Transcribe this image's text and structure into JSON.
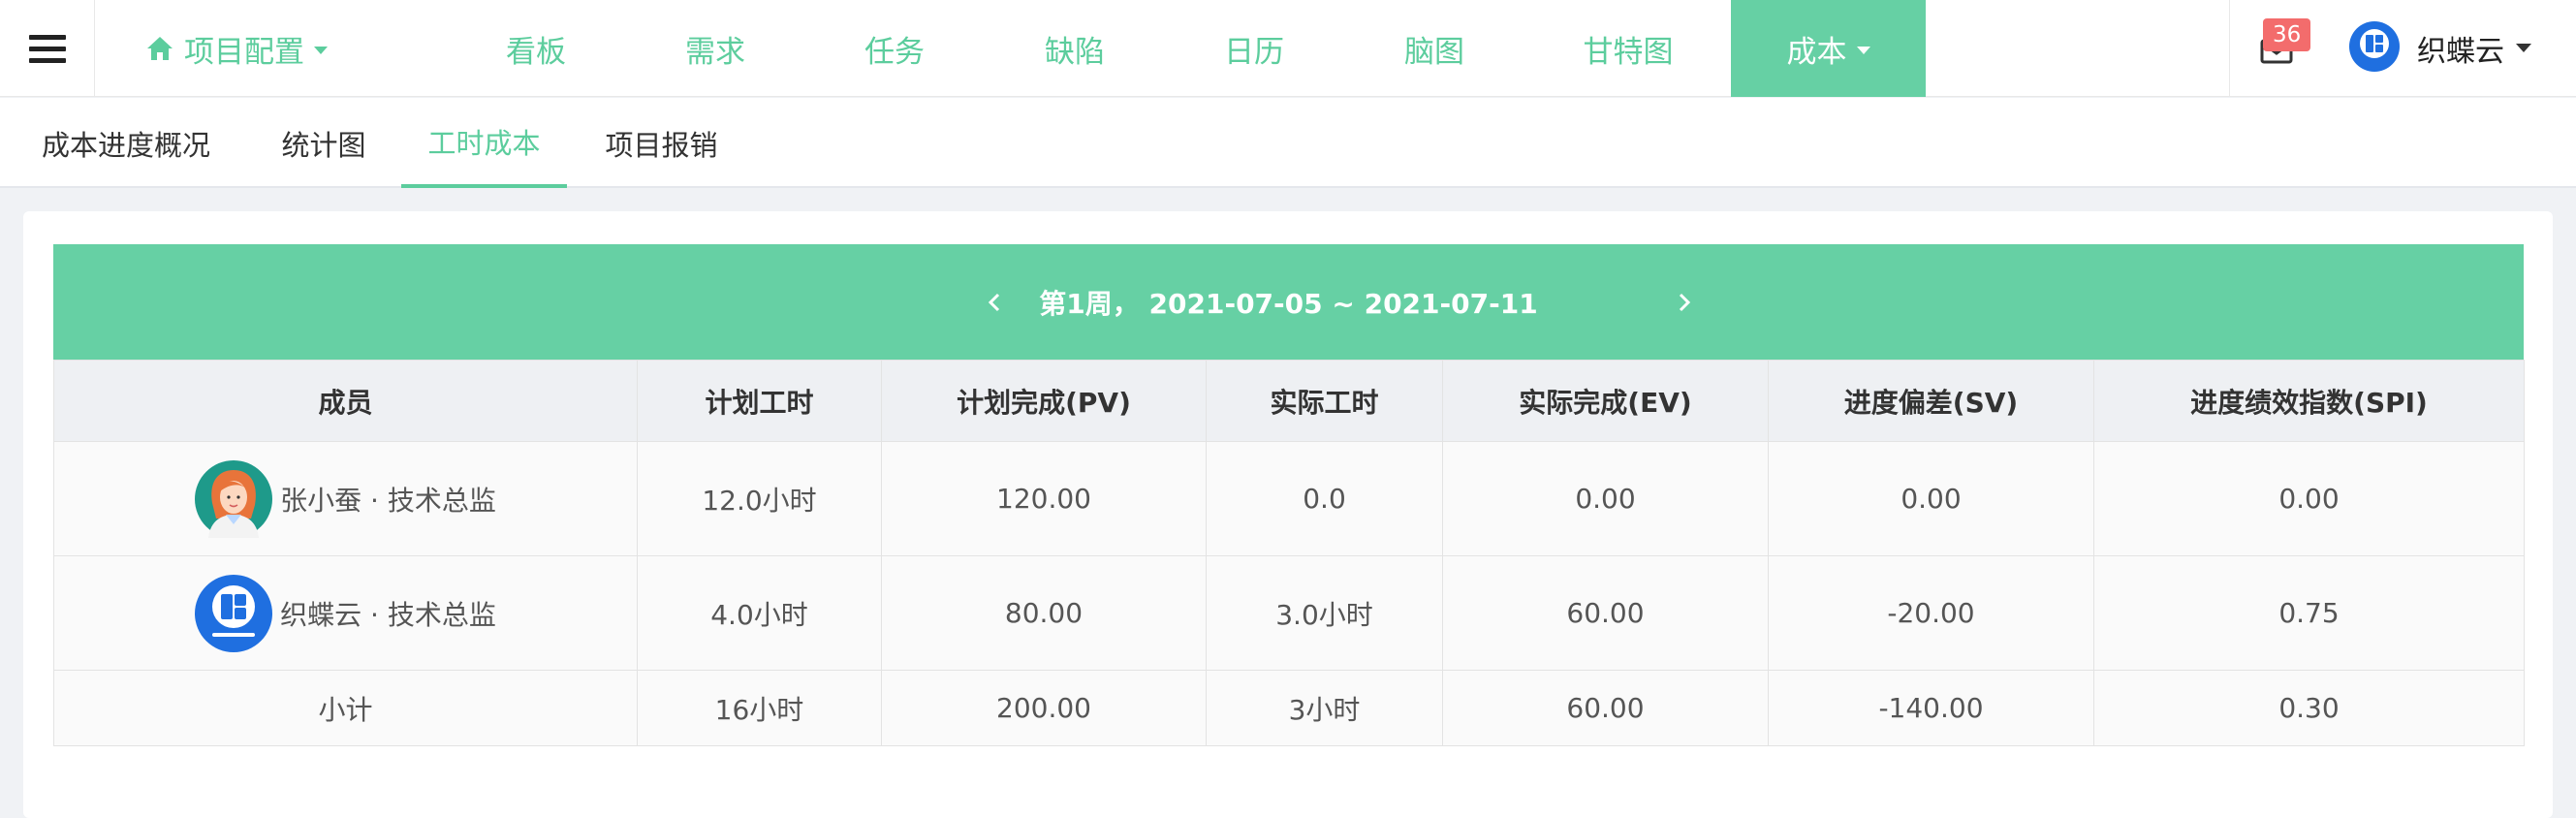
{
  "nav": {
    "project_config": "项目配置",
    "items": [
      "看板",
      "需求",
      "任务",
      "缺陷",
      "日历",
      "脑图",
      "甘特图"
    ],
    "cost": "成本"
  },
  "header": {
    "mail_count": "36",
    "user_name": "织蝶云"
  },
  "subtabs": [
    "成本进度概况",
    "统计图",
    "工时成本",
    "项目报销"
  ],
  "active_subtab": "工时成本",
  "week": {
    "label": "第1周，  2021-07-05 ~ 2021-07-11",
    "prev_icon": "chevron-left-icon",
    "next_icon": "chevron-right-icon"
  },
  "table": {
    "columns": [
      "成员",
      "计划工时",
      "计划完成(PV)",
      "实际工时",
      "实际完成(EV)",
      "进度偏差(SV)",
      "进度绩效指数(SPI)"
    ],
    "rows": [
      {
        "member": "张小蚕 · 技术总监",
        "avatar": "female-avatar",
        "plan_hours": "12.0小时",
        "pv": "120.00",
        "actual_hours": "0.0",
        "ev": "0.00",
        "sv": "0.00",
        "spi": "0.00"
      },
      {
        "member": "织蝶云 · 技术总监",
        "avatar": "brand-logo-avatar",
        "plan_hours": "4.0小时",
        "pv": "80.00",
        "actual_hours": "3.0小时",
        "ev": "60.00",
        "sv": "-20.00",
        "spi": "0.75"
      }
    ],
    "subtotal": {
      "label": "小计",
      "plan_hours": "16小时",
      "pv": "200.00",
      "actual_hours": "3小时",
      "ev": "60.00",
      "sv": "-140.00",
      "spi": "0.30"
    }
  },
  "colors": {
    "accent": "#66d0a4",
    "accent_text": "#5ccd9d",
    "badge": "#f36c6c",
    "brand_blue": "#1f6fe0"
  }
}
